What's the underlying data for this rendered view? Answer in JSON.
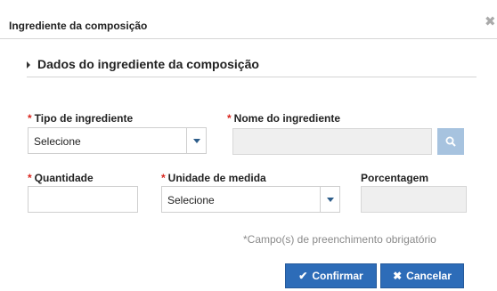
{
  "dialog": {
    "title": "Ingrediente da composição",
    "close_glyph": "✖"
  },
  "section": {
    "title": "Dados do ingrediente da composição"
  },
  "form": {
    "required_marker": "*",
    "tipo": {
      "label": "Tipo de ingrediente",
      "selected": "Selecione",
      "required": true
    },
    "nome": {
      "label": "Nome do ingrediente",
      "value": "",
      "required": true,
      "disabled": true
    },
    "quantidade": {
      "label": "Quantidade",
      "value": "",
      "required": true
    },
    "unidade": {
      "label": "Unidade de medida",
      "selected": "Selecione",
      "required": true
    },
    "porcentagem": {
      "label": "Porcentagem",
      "value": "",
      "required": false,
      "disabled": true
    }
  },
  "required_note": "*Campo(s) de preenchimento obrigatório",
  "buttons": {
    "confirm_label": "Confirmar",
    "confirm_icon": "✔",
    "cancel_label": "Cancelar",
    "cancel_icon": "✖"
  },
  "icons": {
    "search": "search-icon",
    "dropdown": "chevron-down-icon",
    "section_toggle": "caret-right-icon",
    "close": "close-icon"
  },
  "colors": {
    "primary_button": "#2d6cb8",
    "search_button": "#a7c3df",
    "required_asterisk": "#d9251d",
    "disabled_field": "#efefef",
    "note_text": "#8a8a8a"
  }
}
